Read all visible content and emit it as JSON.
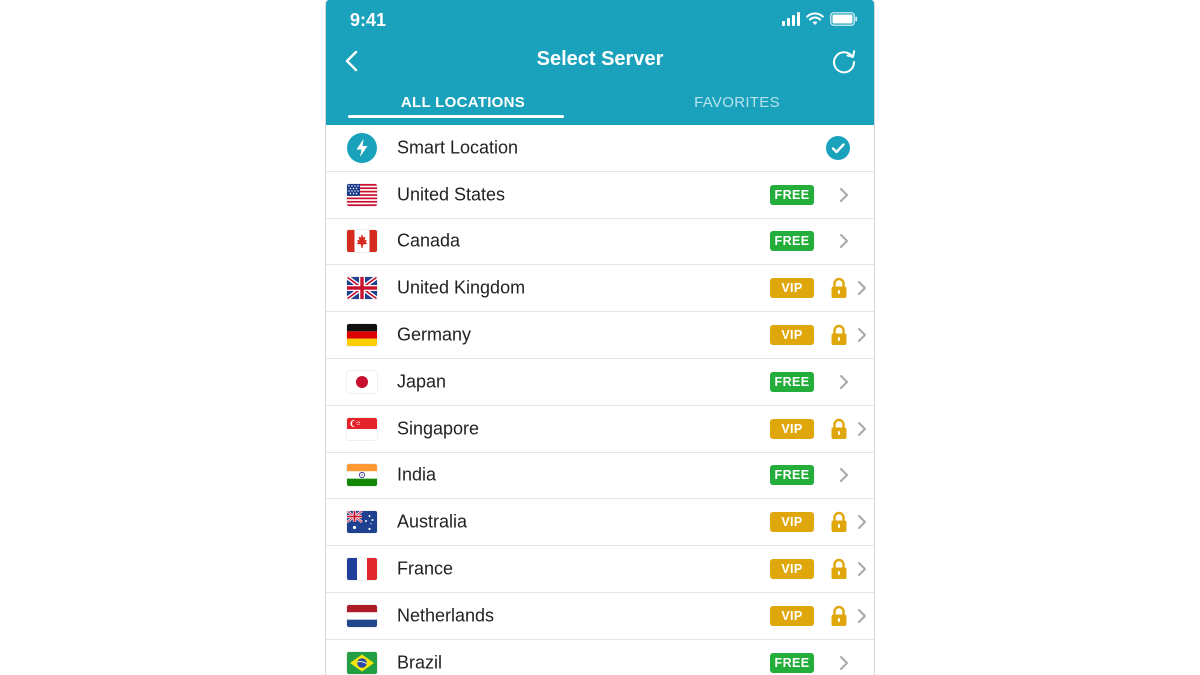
{
  "status_bar": {
    "time": "9:41"
  },
  "header": {
    "title": "Select Server"
  },
  "tabs": [
    {
      "label": "ALL LOCATIONS",
      "active": true
    },
    {
      "label": "FAVORITES",
      "active": false
    }
  ],
  "smart_location": {
    "label": "Smart Location",
    "selected": true
  },
  "locations": [
    {
      "name": "United States",
      "tier": "FREE",
      "flag": "us-flag-icon"
    },
    {
      "name": "Canada",
      "tier": "FREE",
      "flag": "ca-flag-icon"
    },
    {
      "name": "United Kingdom",
      "tier": "VIP",
      "flag": "gb-flag-icon"
    },
    {
      "name": "Germany",
      "tier": "VIP",
      "flag": "de-flag-icon"
    },
    {
      "name": "Japan",
      "tier": "FREE",
      "flag": "jp-flag-icon"
    },
    {
      "name": "Singapore",
      "tier": "VIP",
      "flag": "sg-flag-icon"
    },
    {
      "name": "India",
      "tier": "FREE",
      "flag": "in-flag-icon"
    },
    {
      "name": "Australia",
      "tier": "VIP",
      "flag": "au-flag-icon"
    },
    {
      "name": "France",
      "tier": "VIP",
      "flag": "fr-flag-icon"
    },
    {
      "name": "Netherlands",
      "tier": "VIP",
      "flag": "nl-flag-icon"
    },
    {
      "name": "Brazil",
      "tier": "FREE",
      "flag": "br-flag-icon"
    }
  ],
  "colors": {
    "accent": "#1aa2bd",
    "free": "#23ad3a",
    "vip": "#e0a70c"
  }
}
